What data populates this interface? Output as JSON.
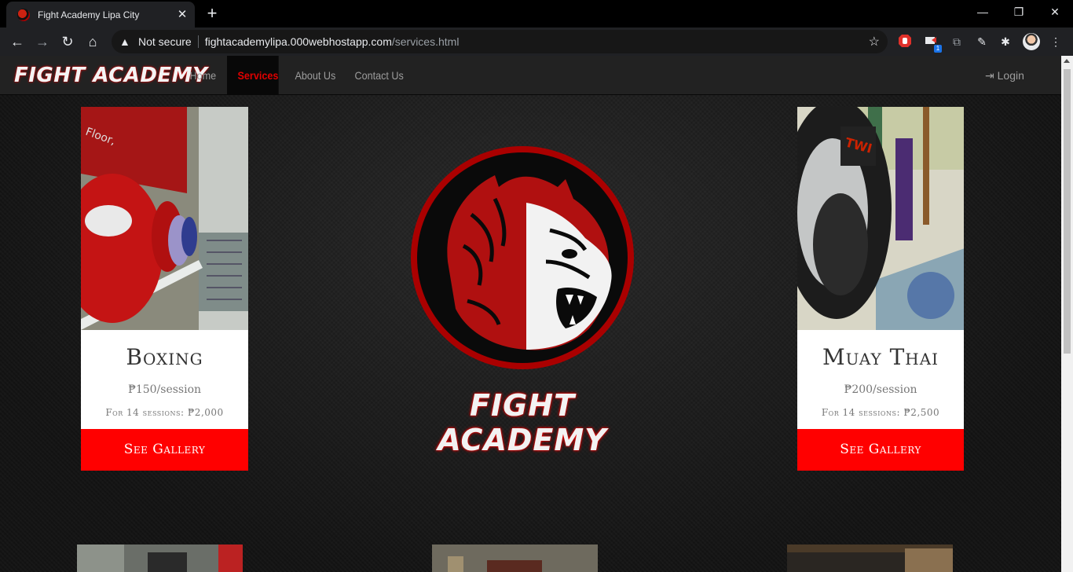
{
  "browser": {
    "tab_title": "Fight Academy Lipa City",
    "close": "✕",
    "new_tab": "+",
    "not_secure": "Not secure",
    "url_host": "fightacademylipa.000webhostapp.com",
    "url_path": "/services.html",
    "ext_badge": "1"
  },
  "site": {
    "brand": "FIGHT ACADEMY",
    "nav": [
      "Home",
      "Services",
      "About Us",
      "Contact Us"
    ],
    "active_nav": "Services",
    "login": "Login",
    "accent": "#ff0000"
  },
  "cards": [
    {
      "title": "Boxing",
      "price": "₱150/session",
      "sessions": "For 14 sessions: ₱2,000",
      "button": "See Gallery"
    },
    {
      "title": "Muay Thai",
      "price": "₱200/session",
      "sessions": "For 14 sessions: ₱2,500",
      "button": "See Gallery"
    }
  ],
  "center": {
    "brand": "FIGHT ACADEMY"
  }
}
